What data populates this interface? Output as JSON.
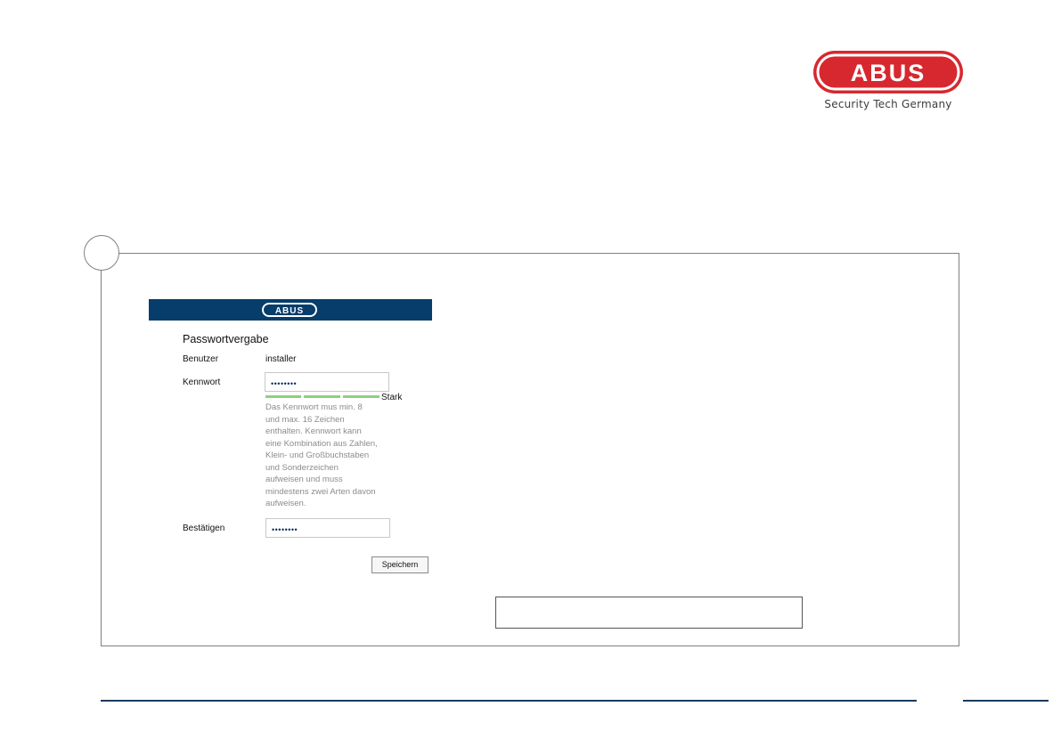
{
  "brand": {
    "logo_text": "ABUS",
    "tagline": "Security Tech Germany",
    "logo_color": "#d7282f"
  },
  "dialog": {
    "header_logo_text": "ABUS",
    "header_color": "#063d6b",
    "title": "Passwortvergabe",
    "user_label": "Benutzer",
    "user_value": "installer",
    "password_label": "Kennwort",
    "password_value": "••••••••",
    "strength_label": "Stark",
    "strength_color": "#8ed17e",
    "hint": "Das Kennwort mus min. 8\nund max. 16 Zeichen\nenthalten. Kennwort kann\neine Kombination aus Zahlen,\nKlein- und Großbuchstaben\nund Sonderzeichen\naufweisen und muss\nmindestens zwei Arten davon\naufweisen.",
    "confirm_label": "Bestätigen",
    "confirm_value": "••••••••",
    "save_label": "Speichern"
  }
}
